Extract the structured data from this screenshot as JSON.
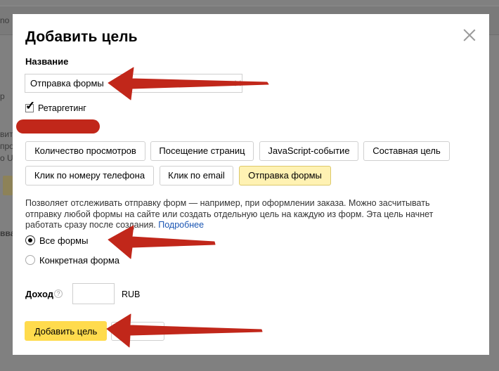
{
  "background": {
    "fragments": [
      "no",
      "p",
      "вить",
      "про",
      "о U",
      "вва"
    ]
  },
  "modal": {
    "title": "Добавить цель",
    "name_label": "Название",
    "name_value": "Отправка формы",
    "retargeting_label": "Ретаргетинг",
    "retargeting_checked": true,
    "goal_types": [
      "Количество просмотров",
      "Посещение страниц",
      "JavaScript-событие",
      "Составная цель",
      "Клик по номеру телефона",
      "Клик по email",
      "Отправка формы"
    ],
    "active_goal_type": "Отправка формы",
    "description": "Позволяет отслеживать отправку форм — например, при оформлении заказа. Можно засчитывать отправку любой формы на сайте или создать отдельную цель на каждую из форм. Эта цель начнет работать сразу после создания.",
    "more_link": "Подробнее",
    "radio_all_forms": "Все формы",
    "radio_specific_form": "Конкретная форма",
    "selected_radio": "Все формы",
    "income_label": "Доход",
    "income_help": "?",
    "income_value": "",
    "currency": "RUB",
    "submit_label": "Добавить цель",
    "cancel_label": ""
  },
  "colors": {
    "accent_yellow": "#ffdb4d",
    "active_chip": "#fff2b3",
    "link": "#1a55b3",
    "annotation_arrow": "#c1271a"
  }
}
